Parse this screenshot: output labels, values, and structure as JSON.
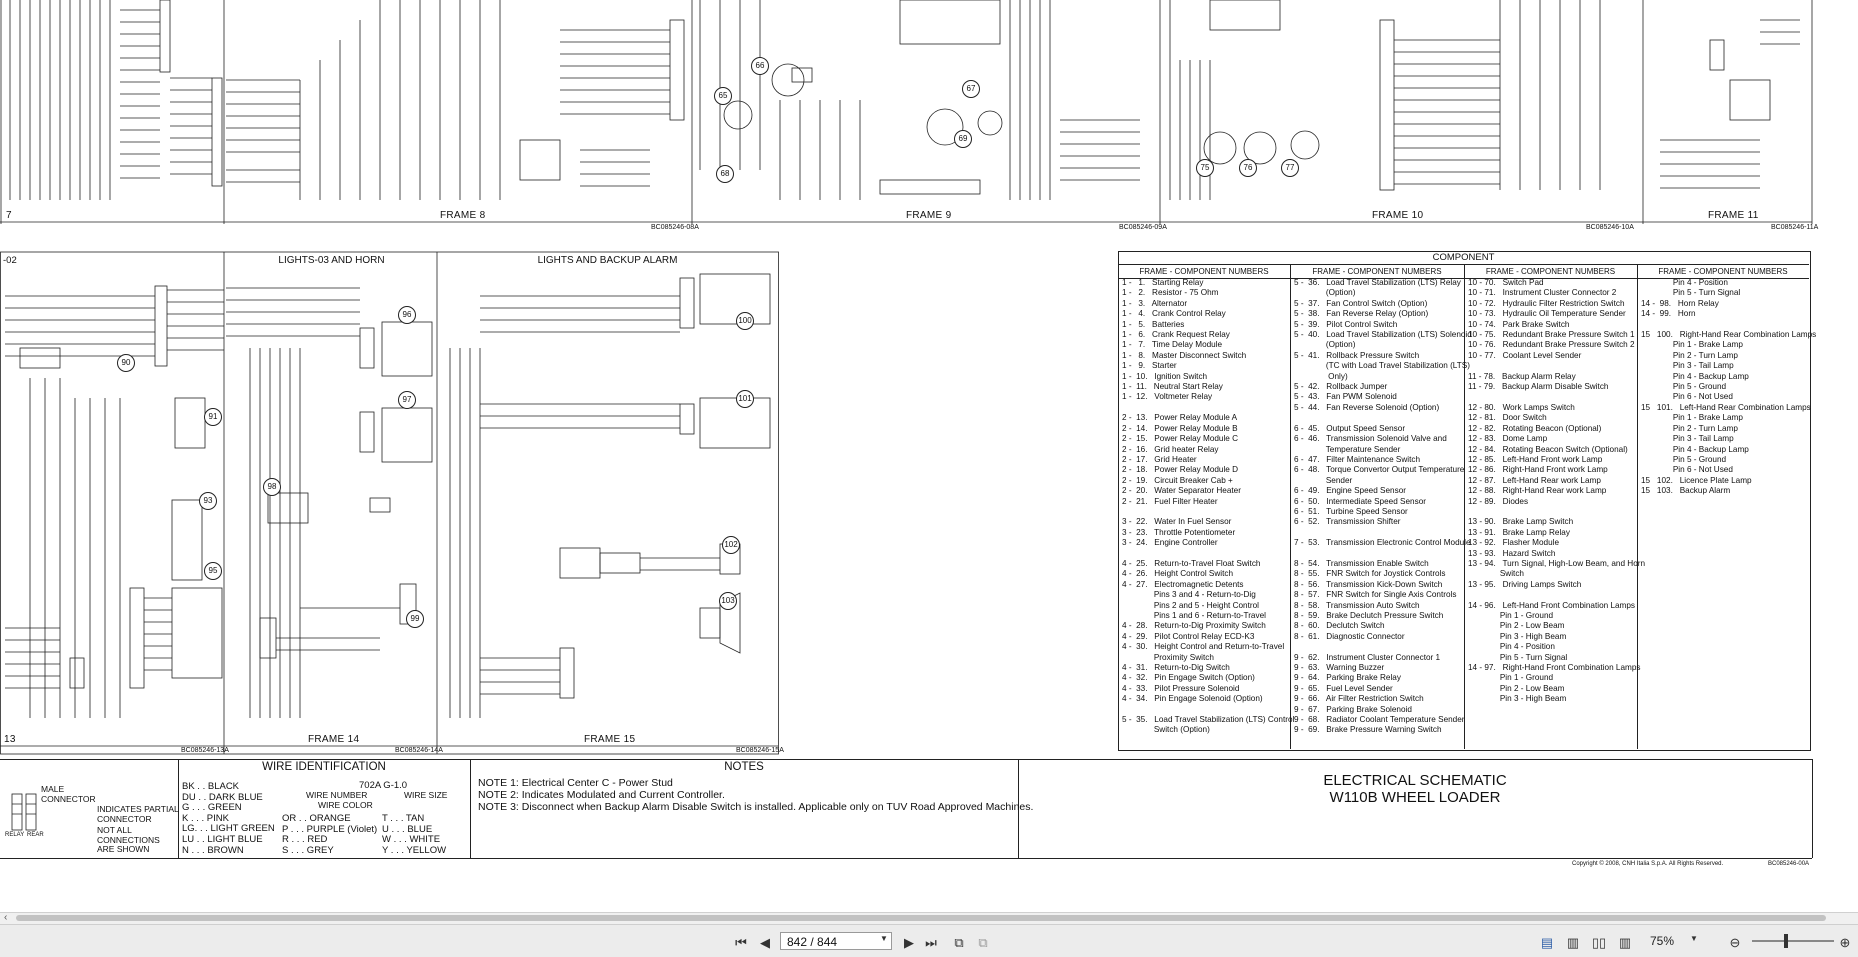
{
  "frames_top": [
    "7",
    "FRAME 8",
    "FRAME 9",
    "FRAME 10",
    "FRAME 11"
  ],
  "frame_codes_top": [
    "BC085246-08A",
    "BC085246-09A",
    "BC085246-10A",
    "BC085246-11A"
  ],
  "panels_mid": {
    "left_label": "-02",
    "lights_horn": "LIGHTS-03 AND HORN",
    "lights_backup": "LIGHTS AND BACKUP ALARM",
    "frames_bottom": [
      "13",
      "FRAME 14",
      "FRAME 15"
    ],
    "frame_codes_bottom": [
      "BC085246-13A",
      "BC085246-14A",
      "BC085246-15A"
    ]
  },
  "component_markers": [
    "65",
    "66",
    "67",
    "68",
    "69",
    "75",
    "76",
    "77",
    "90",
    "91",
    "93",
    "95",
    "96",
    "97",
    "98",
    "99",
    "100",
    "101",
    "102",
    "103"
  ],
  "component_table": {
    "title": "COMPONENT",
    "col_header": "FRAME - COMPONENT NUMBERS",
    "col1": "1 -   1.   Starting Relay\n1 -   2.   Resistor - 75 Ohm\n1 -   3.   Alternator\n1 -   4.   Crank Control Relay\n1 -   5.   Batteries\n1 -   6.   Crank Request Relay\n1 -   7.   Time Delay Module\n1 -   8.   Master Disconnect Switch\n1 -   9.   Starter\n1 -  10.   Ignition Switch\n1 -  11.   Neutral Start Relay\n1 -  12.   Voltmeter Relay\n\n2 -  13.   Power Relay Module A\n2 -  14.   Power Relay Module B\n2 -  15.   Power Relay Module C\n2 -  16.   Grid heater Relay\n2 -  17.   Grid Heater\n2 -  18.   Power Relay Module D\n2 -  19.   Circuit Breaker Cab +\n2 -  20.   Water Separator Heater\n2 -  21.   Fuel Filter Heater\n\n3 -  22.   Water In Fuel Sensor\n3 -  23.   Throttle Potentiometer\n3 -  24.   Engine Controller\n\n4 -  25.   Return-to-Travel Float Switch\n4 -  26.   Height Control Switch\n4 -  27.   Electromagnetic Detents\n              Pins 3 and 4 - Return-to-Dig\n              Pins 2 and 5 - Height Control\n              Pins 1 and 6 - Return-to-Travel\n4 -  28.   Return-to-Dig Proximity Switch\n4 -  29.   Pilot Control Relay ECD-K3\n4 -  30.   Height Control and Return-to-Travel\n              Proximity Switch\n4 -  31.   Return-to-Dig Switch\n4 -  32.   Pin Engage Switch (Option)\n4 -  33.   Pilot Pressure Solenoid\n4 -  34.   Pin Engage Solenoid (Option)\n\n5 -  35.   Load Travel Stabilization (LTS) Control\n              Switch (Option)",
    "col2": "5 -  36.   Load Travel Stabilization (LTS) Relay\n              (Option)\n5 -  37.   Fan Control Switch (Option)\n5 -  38.   Fan Reverse Relay (Option)\n5 -  39.   Pilot Control Switch\n5 -  40.   Load Travel Stabilization (LTS) Solenoid\n              (Option)\n5 -  41.   Rollback Pressure Switch\n              (TC with Load Travel Stabilization (LTS)\n               Only)\n5 -  42.   Rollback Jumper\n5 -  43.   Fan PWM Solenoid\n5 -  44.   Fan Reverse Solenoid (Option)\n\n6 -  45.   Output Speed Sensor\n6 -  46.   Transmission Solenoid Valve and\n              Temperature Sender\n6 -  47.   Filter Maintenance Switch\n6 -  48.   Torque Convertor Output Temperature\n              Sender\n6 -  49.   Engine Speed Sensor\n6 -  50.   Intermediate Speed Sensor\n6 -  51.   Turbine Speed Sensor\n6 -  52.   Transmission Shifter\n\n7 -  53.   Transmission Electronic Control Module\n\n8 -  54.   Transmission Enable Switch\n8 -  55.   FNR Switch for Joystick Controls\n8 -  56.   Transmission Kick-Down Switch\n8 -  57.   FNR Switch for Single Axis Controls\n8 -  58.   Transmission Auto Switch\n8 -  59.   Brake Declutch Pressure Switch\n8 -  60.   Declutch Switch\n8 -  61.   Diagnostic Connector\n\n9 -  62.   Instrument Cluster Connector 1\n9 -  63.   Warning Buzzer\n9 -  64.   Parking Brake Relay\n9 -  65.   Fuel Level Sender\n9 -  66.   Air Filter Restriction Switch\n9 -  67.   Parking Brake Solenoid\n9 -  68.   Radiator Coolant Temperature Sender\n9 -  69.   Brake Pressure Warning Switch",
    "col3": "10 - 70.   Switch Pad\n10 - 71.   Instrument Cluster Connector 2\n10 - 72.   Hydraulic Filter Restriction Switch\n10 - 73.   Hydraulic Oil Temperature Sender\n10 - 74.   Park Brake Switch\n10 - 75.   Redundant Brake Pressure Switch 1\n10 - 76.   Redundant Brake Pressure Switch 2\n10 - 77.   Coolant Level Sender\n\n11 - 78.   Backup Alarm Relay\n11 - 79.   Backup Alarm Disable Switch\n\n12 - 80.   Work Lamps Switch\n12 - 81.   Door Switch\n12 - 82.   Rotating Beacon (Optional)\n12 - 83.   Dome Lamp\n12 - 84.   Rotating Beacon Switch (Optional)\n12 - 85.   Left-Hand Front work Lamp\n12 - 86.   Right-Hand Front work Lamp\n12 - 87.   Left-Hand Rear work Lamp\n12 - 88.   Right-Hand Rear work Lamp\n12 - 89.   Diodes\n\n13 - 90.   Brake Lamp Switch\n13 - 91.   Brake Lamp Relay\n13 - 92.   Flasher Module\n13 - 93.   Hazard Switch\n13 - 94.   Turn Signal, High-Low Beam, and Horn\n              Switch\n13 - 95.   Driving Lamps Switch\n\n14 - 96.   Left-Hand Front Combination Lamps\n              Pin 1 - Ground\n              Pin 2 - Low Beam\n              Pin 3 - High Beam\n              Pin 4 - Position\n              Pin 5 - Turn Signal\n14 - 97.   Right-Hand Front Combination Lamps\n              Pin 1 - Ground\n              Pin 2 - Low Beam\n              Pin 3 - High Beam",
    "col4": "              Pin 4 - Position\n              Pin 5 - Turn Signal\n14 -  98.   Horn Relay\n14 -  99.   Horn\n\n15   100.   Right-Hand Rear Combination Lamps\n              Pin 1 - Brake Lamp\n              Pin 2 - Turn Lamp\n              Pin 3 - Tail Lamp\n              Pin 4 - Backup Lamp\n              Pin 5 - Ground\n              Pin 6 - Not Used\n15   101.   Left-Hand Rear Combination Lamps\n              Pin 1 - Brake Lamp\n              Pin 2 - Turn Lamp\n              Pin 3 - Tail Lamp\n              Pin 4 - Backup Lamp\n              Pin 5 - Ground\n              Pin 6 - Not Used\n15   102.   Licence Plate Lamp\n15   103.   Backup Alarm"
  },
  "legend": {
    "male_connector": "MALE\nCONNECTOR",
    "partial_connector": "INDICATES PARTIAL\nCONNECTOR",
    "not_all": "NOT ALL\nCONNECTIONS\nARE SHOWN",
    "relay": "RELAY",
    "rear": "REAR"
  },
  "wire_identification": {
    "title": "WIRE IDENTIFICATION",
    "codes_a": "BK . . BLACK\nDU . . DARK BLUE\nG . . . GREEN\nK . . . PINK\nLG. . . LIGHT GREEN\nLU . . LIGHT BLUE\nN . . . BROWN",
    "example": "702A G-1.0",
    "wire_number": "WIRE NUMBER",
    "wire_color": "WIRE COLOR",
    "wire_size": "WIRE SIZE",
    "codes_b": "OR . . ORANGE\nP . . . PURPLE (Violet)\nR . . . RED\nS . . . GREY",
    "codes_c": "T . . . TAN\nU . . . BLUE\nW . . . WHITE\nY . . . YELLOW"
  },
  "notes": {
    "title": "NOTES",
    "lines": [
      "NOTE 1: Electrical Center C - Power Stud",
      "NOTE 2: Indicates Modulated and Current Controller.",
      "NOTE 3: Disconnect when Backup Alarm Disable Switch is installed. Applicable only on TUV Road Approved Machines."
    ]
  },
  "schematic_title": {
    "line1": "ELECTRICAL SCHEMATIC",
    "line2": "W110B WHEEL LOADER",
    "copyright": "Copyright © 2008, CNH Italia S.p.A. All Rights Reserved.",
    "code": "BC085246-00A"
  },
  "viewer": {
    "page_value": "842 / 844",
    "zoom_value": "75%",
    "colors": {
      "toolbar": "#ececec",
      "accent": "#5b8bd0"
    }
  }
}
